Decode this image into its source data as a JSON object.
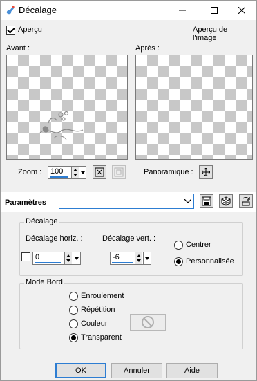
{
  "window": {
    "title": "Décalage",
    "icons": {
      "app": "paint-brush-icon",
      "minimize": "minimize-icon",
      "maximize": "maximize-icon",
      "close": "close-icon"
    }
  },
  "preview": {
    "section_label": "Aperçu",
    "image_preview_label": "Aperçu de l'image",
    "image_preview_checked": true,
    "before_label": "Avant :",
    "after_label": "Après :",
    "zoom_label": "Zoom :",
    "zoom_value": "100",
    "pan_label": "Panoramique :",
    "icons": {
      "collapse": "chevron-down-icon",
      "fit": "fit-to-window-icon",
      "actual_size": "actual-size-icon",
      "pan": "move-icon"
    }
  },
  "params": {
    "label": "Paramètres",
    "preset_value": "",
    "icons": {
      "save": "save-icon",
      "random": "dice-icon",
      "reset": "reset-icon"
    }
  },
  "offset": {
    "group_title": "Décalage",
    "horiz_label": "Décalage horiz. :",
    "horiz_value": "0",
    "vert_label": "Décalage vert. :",
    "vert_value": "-6",
    "link_checked": false,
    "center_label": "Centrer",
    "custom_label": "Personnalisée",
    "selected": "Personnalisée"
  },
  "edge_mode": {
    "group_title": "Mode Bord",
    "options": [
      "Enroulement",
      "Répétition",
      "Couleur",
      "Transparent"
    ],
    "selected": "Transparent",
    "color_swatch_icon": "no-color-icon"
  },
  "buttons": {
    "ok": "OK",
    "cancel": "Annuler",
    "help": "Aide"
  },
  "colors": {
    "accent": "#2d7dd2",
    "window_bg": "#f0f0f0",
    "checker": "#c8c8c8"
  }
}
